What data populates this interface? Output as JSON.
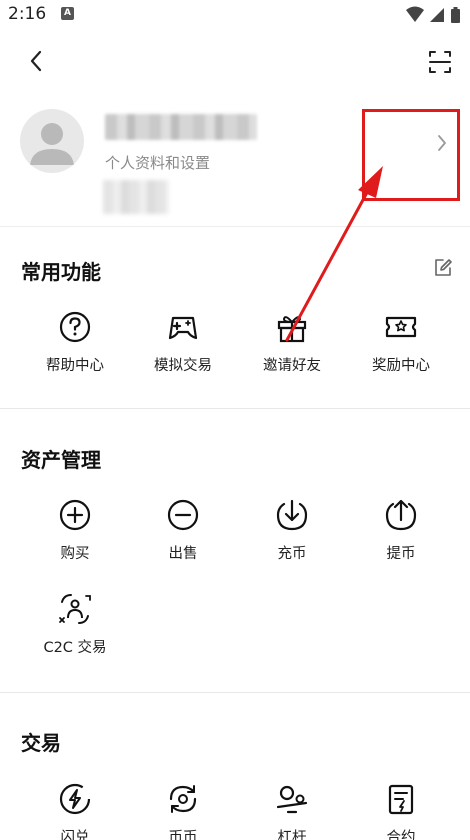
{
  "status_bar": {
    "time": "2:16",
    "app_icon": "A",
    "icons": [
      "wifi-icon",
      "signal-icon",
      "battery-icon"
    ]
  },
  "top_nav": {
    "back_icon": "back-arrow-icon",
    "scan_icon": "scan-icon"
  },
  "profile": {
    "subtitle": "个人资料和设置",
    "username": "",
    "uid": ""
  },
  "sections": {
    "common": {
      "title": "常用功能",
      "items": [
        {
          "label": "帮助中心",
          "icon": "help-icon"
        },
        {
          "label": "模拟交易",
          "icon": "gamepad-icon"
        },
        {
          "label": "邀请好友",
          "icon": "gift-icon"
        },
        {
          "label": "奖励中心",
          "icon": "ticket-icon"
        }
      ]
    },
    "assets": {
      "title": "资产管理",
      "items": [
        {
          "label": "购买",
          "icon": "plus-circle-icon"
        },
        {
          "label": "出售",
          "icon": "minus-circle-icon"
        },
        {
          "label": "充币",
          "icon": "deposit-icon"
        },
        {
          "label": "提币",
          "icon": "withdraw-icon"
        },
        {
          "label": "C2C 交易",
          "icon": "c2c-icon"
        }
      ]
    },
    "trade": {
      "title": "交易",
      "items": [
        {
          "label": "闪兑",
          "icon": "flash-icon"
        },
        {
          "label": "币币",
          "icon": "spot-icon"
        },
        {
          "label": "杠杆",
          "icon": "margin-icon"
        },
        {
          "label": "合约",
          "icon": "contract-icon"
        }
      ]
    }
  },
  "colors": {
    "annotation_red": "#e01b1b",
    "text_primary": "#111111",
    "text_secondary": "#8a8a8a"
  }
}
